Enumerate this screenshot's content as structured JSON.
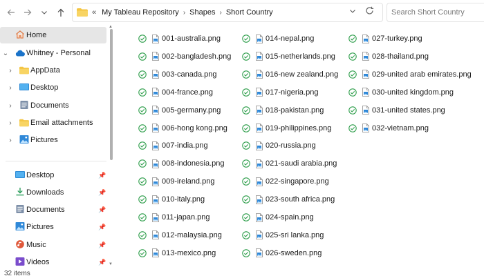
{
  "toolbar": {
    "breadcrumb_overflow": "«",
    "breadcrumbs": [
      "My Tableau Repository",
      "Shapes",
      "Short Country"
    ],
    "search_placeholder": "Search Short Country"
  },
  "sidebar": {
    "tree": [
      {
        "label": "Home",
        "icon": "home-icon",
        "chevron": "",
        "selected": true
      },
      {
        "label": "Whitney - Personal",
        "icon": "cloud-icon",
        "chevron": "down"
      },
      {
        "label": "AppData",
        "icon": "folder-icon",
        "chevron": "right"
      },
      {
        "label": "Desktop",
        "icon": "desktop-icon",
        "chevron": "right"
      },
      {
        "label": "Documents",
        "icon": "documents-icon",
        "chevron": "right"
      },
      {
        "label": "Email attachments",
        "icon": "folder-icon",
        "chevron": "right"
      },
      {
        "label": "Pictures",
        "icon": "pictures-icon",
        "chevron": "right"
      }
    ],
    "quick_access": [
      {
        "label": "Desktop",
        "icon": "desktop-icon"
      },
      {
        "label": "Downloads",
        "icon": "download-icon"
      },
      {
        "label": "Documents",
        "icon": "documents-icon"
      },
      {
        "label": "Pictures",
        "icon": "pictures-icon"
      },
      {
        "label": "Music",
        "icon": "music-icon"
      },
      {
        "label": "Videos",
        "icon": "videos-icon"
      }
    ]
  },
  "files": [
    "001-australia.png",
    "002-bangladesh.png",
    "003-canada.png",
    "004-france.png",
    "005-germany.png",
    "006-hong kong.png",
    "007-india.png",
    "008-indonesia.png",
    "009-ireland.png",
    "010-italy.png",
    "011-japan.png",
    "012-malaysia.png",
    "013-mexico.png",
    "014-nepal.png",
    "015-netherlands.png",
    "016-new zealand.png",
    "017-nigeria.png",
    "018-pakistan.png",
    "019-philippines.png",
    "020-russia.png",
    "021-saudi arabia.png",
    "022-singapore.png",
    "023-south africa.png",
    "024-spain.png",
    "025-sri lanka.png",
    "026-sweden.png",
    "027-turkey.png",
    "028-thailand.png",
    "029-united arab emirates.png",
    "030-united kingdom.png",
    "031-united states.png",
    "032-vietnam.png"
  ],
  "status": {
    "item_count": "32 items"
  },
  "colors": {
    "sync_green": "#2e9e4b",
    "folder_yellow": "#f4c542",
    "accent_blue": "#1a73c9"
  }
}
